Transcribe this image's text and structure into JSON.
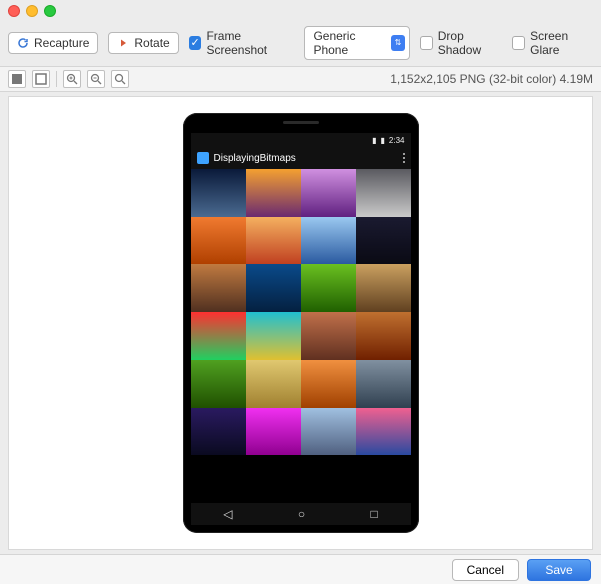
{
  "toolbar": {
    "recapture_label": "Recapture",
    "rotate_label": "Rotate",
    "frame_screenshot_label": "Frame Screenshot",
    "frame_screenshot_checked": true,
    "device_select_value": "Generic Phone",
    "drop_shadow_label": "Drop Shadow",
    "drop_shadow_checked": false,
    "screen_glare_label": "Screen Glare",
    "screen_glare_checked": false
  },
  "viewbar": {
    "image_info": "1,152x2,105 PNG (32-bit color) 4.19M"
  },
  "phone": {
    "statusbar": {
      "signal": "▮",
      "battery": "▮",
      "time": "2:34"
    },
    "app_title": "DisplayingBitmaps",
    "nav": {
      "back": "◁",
      "home": "○",
      "recent": "□"
    },
    "grid_colors": [
      [
        "linear-gradient(#0a1a3a,#4a6a90)",
        "linear-gradient(#f4a030,#6a2a70)",
        "linear-gradient(#d090e0,#602080)",
        "linear-gradient(#5a5a60,#cacaca)"
      ],
      [
        "linear-gradient(#f07a30,#b04000)",
        "linear-gradient(#f4b060,#c04020)",
        "linear-gradient(#9ac8f0,#2a5aa0)",
        "linear-gradient(#1a1a30,#0a0a14)"
      ],
      [
        "linear-gradient(#c07a40,#503020)",
        "linear-gradient(#0a4a8a,#042040)",
        "linear-gradient(#6ac020,#206000)",
        "linear-gradient(#caa060,#604020)"
      ],
      [
        "linear-gradient(#ff3030,#20d060)",
        "linear-gradient(#20c0d0,#e0c030)",
        "linear-gradient(#c0704a,#603020)",
        "linear-gradient(#c07030,#702000)"
      ],
      [
        "linear-gradient(#50a020,#205000)",
        "linear-gradient(#e0c870,#a08030)",
        "linear-gradient(#f09040,#a04000)",
        "linear-gradient(#8090a0,#304050)"
      ],
      [
        "linear-gradient(#2a1a60,#0a0a20)",
        "linear-gradient(#f030f0,#900090)",
        "linear-gradient(#a0c0e0,#506080)",
        "linear-gradient(#f06090,#2a4aa0)"
      ],
      [
        "#000",
        "#000",
        "#000",
        "#000"
      ]
    ]
  },
  "bottom": {
    "cancel_label": "Cancel",
    "save_label": "Save"
  }
}
